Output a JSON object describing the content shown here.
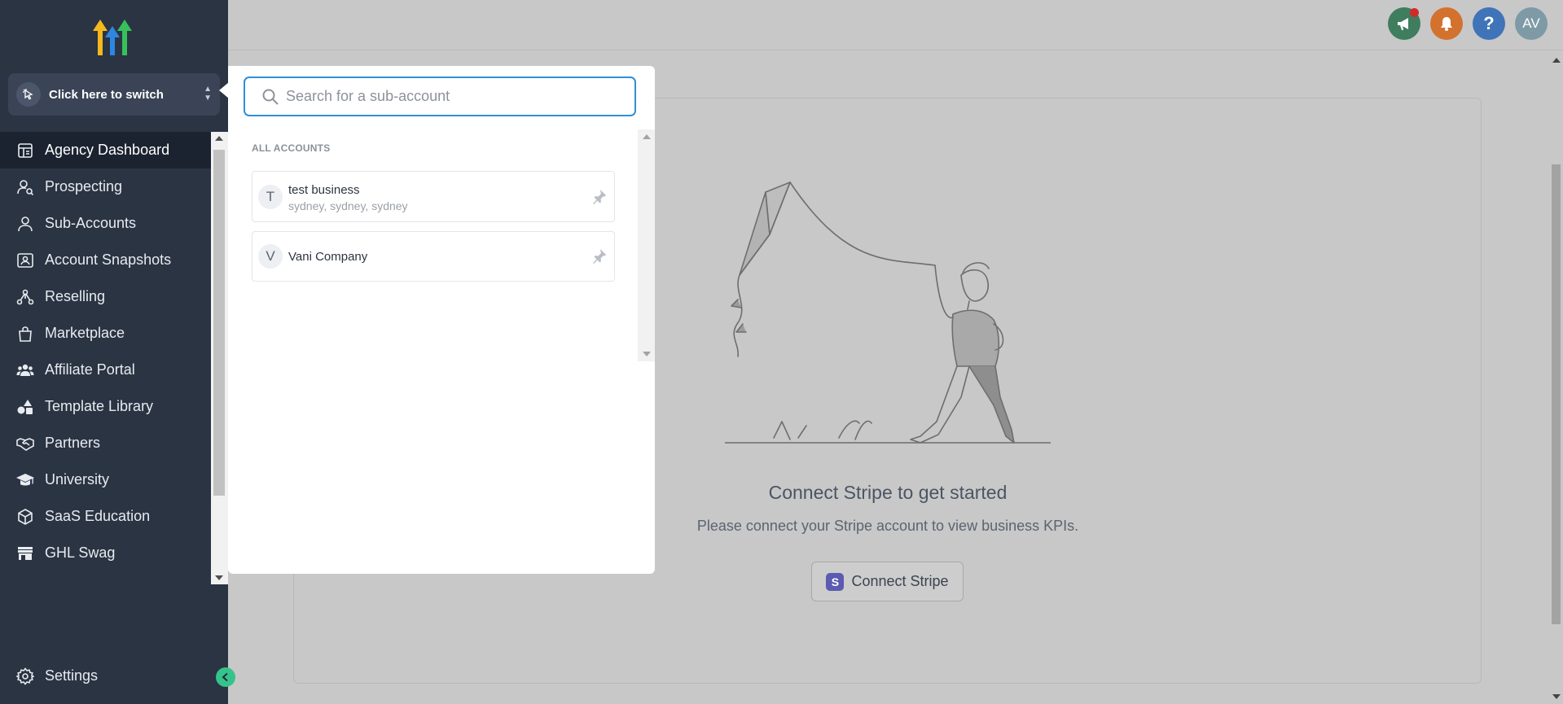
{
  "sidebar": {
    "logo_icon": "highlevel-arrows-logo",
    "switcher": {
      "label": "Click here to switch",
      "icon": "pointer-click-icon"
    },
    "nav_items": [
      {
        "label": "Agency Dashboard",
        "icon": "dashboard-icon",
        "active": true
      },
      {
        "label": "Prospecting",
        "icon": "user-search-icon"
      },
      {
        "label": "Sub-Accounts",
        "icon": "user-icon"
      },
      {
        "label": "Account Snapshots",
        "icon": "snapshot-icon"
      },
      {
        "label": "Reselling",
        "icon": "network-icon"
      },
      {
        "label": "Marketplace",
        "icon": "bag-icon"
      },
      {
        "label": "Affiliate Portal",
        "icon": "users-group-icon"
      },
      {
        "label": "Template Library",
        "icon": "shapes-icon"
      },
      {
        "label": "Partners",
        "icon": "handshake-icon"
      },
      {
        "label": "University",
        "icon": "graduation-cap-icon"
      },
      {
        "label": "SaaS Education",
        "icon": "cube-icon"
      },
      {
        "label": "GHL Swag",
        "icon": "store-icon"
      }
    ],
    "settings_label": "Settings",
    "colors": {
      "background": "#2a3443",
      "active_item": "#1b2330",
      "collapse_button": "#35c38b"
    }
  },
  "topbar": {
    "announce_icon": "megaphone-icon",
    "bell_icon": "bell-icon",
    "help_label": "?",
    "avatar_initials": "AV",
    "colors": {
      "announce": "#3f7d5f",
      "bell": "#d3722e",
      "help": "#3f74b8",
      "avatar": "#7e9aa6"
    }
  },
  "empty_state": {
    "illustration": "kite-man-illustration",
    "title": "Connect Stripe to get started",
    "description": "Please connect your Stripe account to view business KPIs.",
    "button_label": "Connect Stripe",
    "button_logo_letter": "S"
  },
  "popover": {
    "search_placeholder": "Search for a sub-account",
    "search_value": "",
    "heading": "ALL ACCOUNTS",
    "accounts": [
      {
        "initial": "T",
        "name": "test business",
        "location": "sydney, sydney, sydney"
      },
      {
        "initial": "V",
        "name": "Vani Company",
        "location": ""
      }
    ],
    "colors": {
      "search_border": "#2f8fd8"
    }
  }
}
